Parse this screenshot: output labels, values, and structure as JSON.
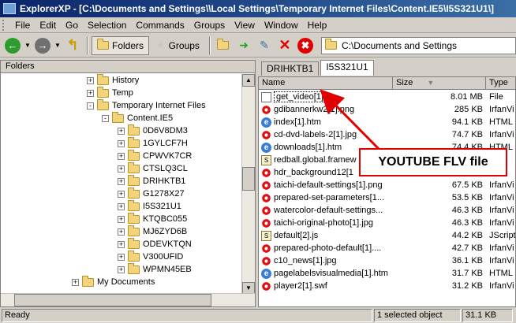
{
  "window": {
    "title": "ExplorerXP - [C:\\Documents and Settings\\\\Local Settings\\Temporary Internet Files\\Content.IE5\\I5S321U1\\]"
  },
  "menu": [
    "File",
    "Edit",
    "Go",
    "Selection",
    "Commands",
    "Groups",
    "View",
    "Window",
    "Help"
  ],
  "toolbar": {
    "folders_label": "Folders",
    "groups_label": "Groups",
    "address": "C:\\Documents and Settings"
  },
  "left_pane": {
    "header": "Folders",
    "tree": [
      {
        "label": "History",
        "level": 0,
        "expander": "+"
      },
      {
        "label": "Temp",
        "level": 0,
        "expander": "+"
      },
      {
        "label": "Temporary Internet Files",
        "level": 0,
        "expander": "-"
      },
      {
        "label": "Content.IE5",
        "level": 1,
        "expander": "-"
      },
      {
        "label": "0D6V8DM3",
        "level": 2,
        "expander": "+"
      },
      {
        "label": "1GYLCF7H",
        "level": 2,
        "expander": "+"
      },
      {
        "label": "CPWVK7CR",
        "level": 2,
        "expander": "+"
      },
      {
        "label": "CTSLQ3CL",
        "level": 2,
        "expander": "+"
      },
      {
        "label": "DRIHKTB1",
        "level": 2,
        "expander": "+"
      },
      {
        "label": "G1278X27",
        "level": 2,
        "expander": "+"
      },
      {
        "label": "I5S321U1",
        "level": 2,
        "expander": "+"
      },
      {
        "label": "KTQBC055",
        "level": 2,
        "expander": "+"
      },
      {
        "label": "MJ6ZYD6B",
        "level": 2,
        "expander": "+"
      },
      {
        "label": "ODEVKTQN",
        "level": 2,
        "expander": "+"
      },
      {
        "label": "V300UFID",
        "level": 2,
        "expander": "+"
      },
      {
        "label": "WPMN45EB",
        "level": 2,
        "expander": "+"
      },
      {
        "label": "My Documents",
        "level": -1,
        "expander": "+"
      }
    ]
  },
  "tabs": [
    "DRIHKTB1",
    "I5S321U1"
  ],
  "file_list": {
    "columns": [
      "Name",
      "Size",
      "Type"
    ],
    "rows": [
      {
        "name": "get_video[1]",
        "size": "8.01 MB",
        "type": "File",
        "icon": "blank-document-icon"
      },
      {
        "name": "gdibannerkw2[1].png",
        "size": "285 KB",
        "type": "IrfanVi",
        "icon": "irfanview-icon"
      },
      {
        "name": "index[1].htm",
        "size": "94.1 KB",
        "type": "HTML D",
        "icon": "ie-html-icon"
      },
      {
        "name": "cd-dvd-labels-2[1].jpg",
        "size": "74.7 KB",
        "type": "IrfanVi",
        "icon": "irfanview-icon"
      },
      {
        "name": "downloads[1].htm",
        "size": "74.4 KB",
        "type": "HTML D",
        "icon": "ie-html-icon"
      },
      {
        "name": "redball.global.framew",
        "size": "",
        "type": "",
        "icon": "script-icon"
      },
      {
        "name": "hdr_background12[1",
        "size": "",
        "type": "",
        "icon": "irfanview-icon"
      },
      {
        "name": "taichi-default-settings[1].png",
        "size": "67.5 KB",
        "type": "IrfanVi",
        "icon": "irfanview-icon"
      },
      {
        "name": "prepared-set-parameters[1...",
        "size": "53.5 KB",
        "type": "IrfanVi",
        "icon": "irfanview-icon"
      },
      {
        "name": "watercolor-default-settings...",
        "size": "46.3 KB",
        "type": "IrfanVi",
        "icon": "irfanview-icon"
      },
      {
        "name": "taichi-original-photo[1].jpg",
        "size": "46.3 KB",
        "type": "IrfanVi",
        "icon": "irfanview-icon"
      },
      {
        "name": "default[2].js",
        "size": "44.2 KB",
        "type": "JScript",
        "icon": "script-icon"
      },
      {
        "name": "prepared-photo-default[1]....",
        "size": "42.7 KB",
        "type": "IrfanVi",
        "icon": "irfanview-icon"
      },
      {
        "name": "c10_news[1].jpg",
        "size": "36.1 KB",
        "type": "IrfanVi",
        "icon": "irfanview-icon"
      },
      {
        "name": "pagelabelsvisualmedia[1].htm",
        "size": "31.7 KB",
        "type": "HTML D",
        "icon": "ie-html-icon"
      },
      {
        "name": "player2[1].swf",
        "size": "31.2 KB",
        "type": "IrfanVi",
        "icon": "irfanview-icon"
      }
    ]
  },
  "annotation": {
    "text": "YOUTUBE  FLV file",
    "color": "#e00000"
  },
  "status": {
    "left": "Ready",
    "middle": "1 selected object",
    "right": "31.1 KB"
  }
}
